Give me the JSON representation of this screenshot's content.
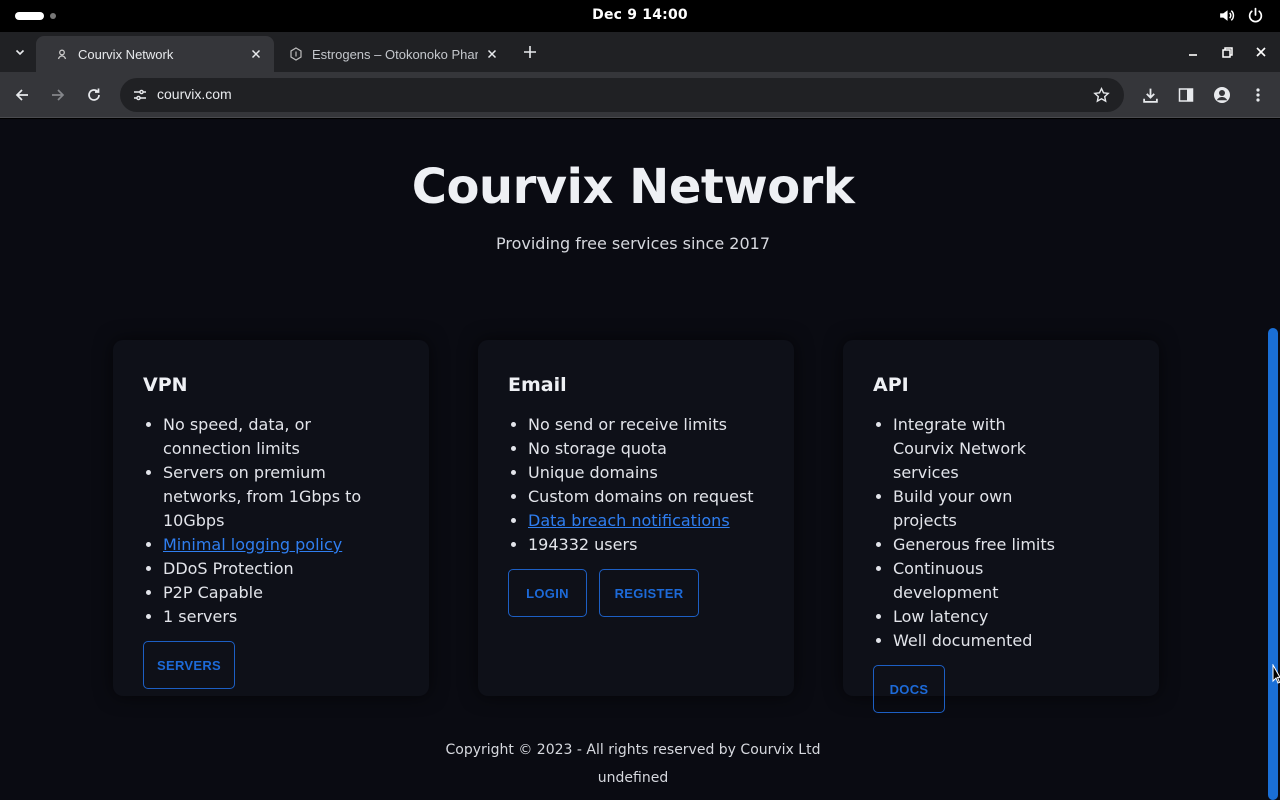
{
  "system": {
    "clock": "Dec 9  14:00"
  },
  "browser": {
    "tabs": [
      {
        "title": "Courvix Network",
        "active": true
      },
      {
        "title": "Estrogens – Otokonoko Pharma",
        "active": false
      }
    ],
    "url": "courvix.com"
  },
  "page": {
    "title": "Courvix Network",
    "subtitle": "Providing free services since 2017",
    "cards": [
      {
        "title": "VPN",
        "items": [
          {
            "text": "No speed, data, or connection limits",
            "link": false
          },
          {
            "text": "Servers on premium networks, from 1Gbps to 10Gbps",
            "link": false
          },
          {
            "text": "Minimal logging policy",
            "link": true
          },
          {
            "text": "DDoS Protection",
            "link": false
          },
          {
            "text": "P2P Capable",
            "link": false
          },
          {
            "text": "1 servers",
            "link": false
          }
        ],
        "buttons": [
          "SERVERS"
        ]
      },
      {
        "title": "Email",
        "items": [
          {
            "text": "No send or receive limits",
            "link": false
          },
          {
            "text": "No storage quota",
            "link": false
          },
          {
            "text": "Unique domains",
            "link": false
          },
          {
            "text": "Custom domains on request",
            "link": false
          },
          {
            "text": "Data breach notifications",
            "link": true
          },
          {
            "text": "194332 users",
            "link": false
          }
        ],
        "buttons": [
          "LOGIN",
          "REGISTER"
        ]
      },
      {
        "title": "API",
        "items": [
          {
            "text": "Integrate with Courvix Network services",
            "link": false
          },
          {
            "text": "Build your own projects",
            "link": false
          },
          {
            "text": "Generous free limits",
            "link": false
          },
          {
            "text": "Continuous development",
            "link": false
          },
          {
            "text": "Low latency",
            "link": false
          },
          {
            "text": "Well documented",
            "link": false
          }
        ],
        "buttons": [
          "DOCS"
        ]
      }
    ],
    "footer": {
      "copyright": "Copyright © 2023 - All rights reserved by Courvix Ltd",
      "extra": "undefined"
    }
  },
  "colors": {
    "accent": "#1d6ad8",
    "link": "#2f7ef0",
    "page_bg": "#0a0b12",
    "card_bg": "#0e1018"
  }
}
